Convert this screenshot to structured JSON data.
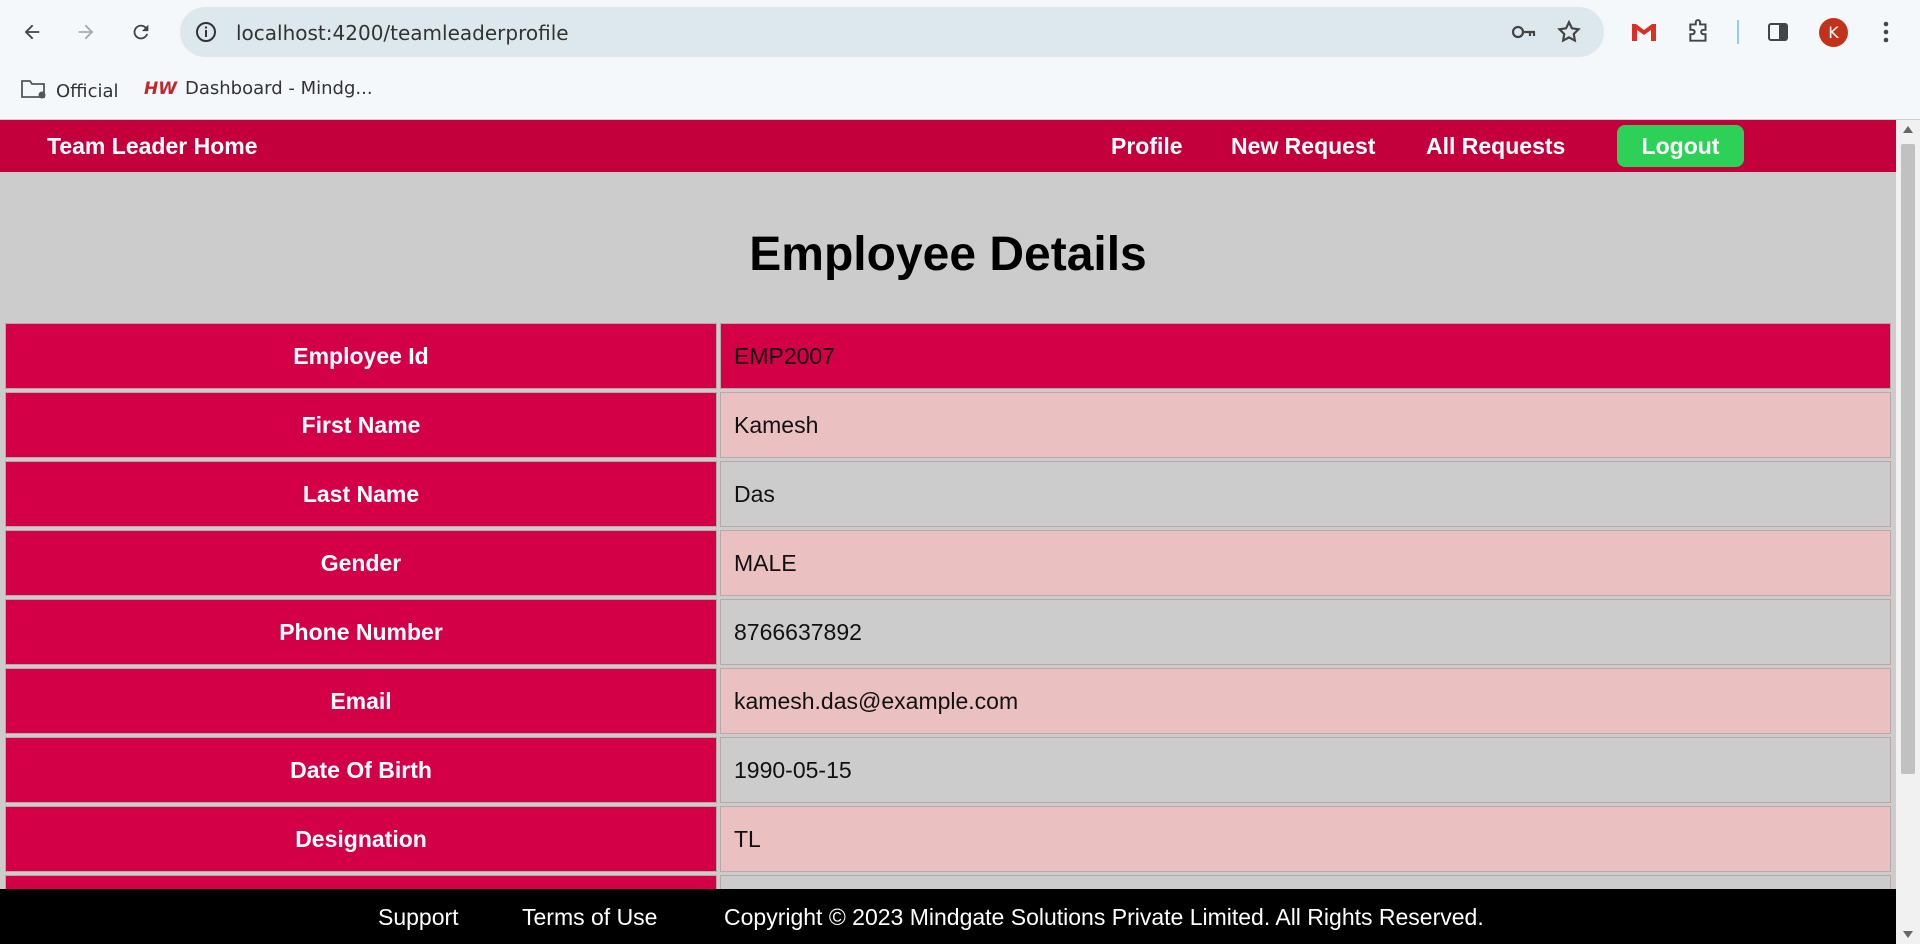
{
  "browser": {
    "url": "localhost:4200/teamleaderprofile",
    "profile_initial": "K",
    "bookmarks": [
      {
        "label": "Official",
        "icon": "folder-settings-icon"
      },
      {
        "label": "Dashboard - Mindg...",
        "icon": "hw-favicon"
      }
    ]
  },
  "appbar": {
    "brand": "Team Leader Home",
    "links": [
      "Profile",
      "New Request",
      "All Requests"
    ],
    "logout": "Logout"
  },
  "main": {
    "title": "Employee Details",
    "rows": [
      {
        "label": "Employee Id",
        "value": "EMP2007"
      },
      {
        "label": "First Name",
        "value": "Kamesh"
      },
      {
        "label": "Last Name",
        "value": "Das"
      },
      {
        "label": "Gender",
        "value": "MALE"
      },
      {
        "label": "Phone Number",
        "value": "8766637892"
      },
      {
        "label": "Email",
        "value": "kamesh.das@example.com"
      },
      {
        "label": "Date Of Birth",
        "value": "1990-05-15"
      },
      {
        "label": "Designation",
        "value": "TL"
      },
      {
        "label": "",
        "value": ""
      }
    ]
  },
  "footer": {
    "support": "Support",
    "terms": "Terms of Use",
    "copyright": "Copyright © 2023 Mindgate Solutions Private Limited. All Rights Reserved."
  },
  "colors": {
    "appbar": "#c3003c",
    "label_cell": "#d40047",
    "pink_row": "#ebc0c1",
    "grey_row": "#cccccc",
    "logout": "#2ed158"
  }
}
